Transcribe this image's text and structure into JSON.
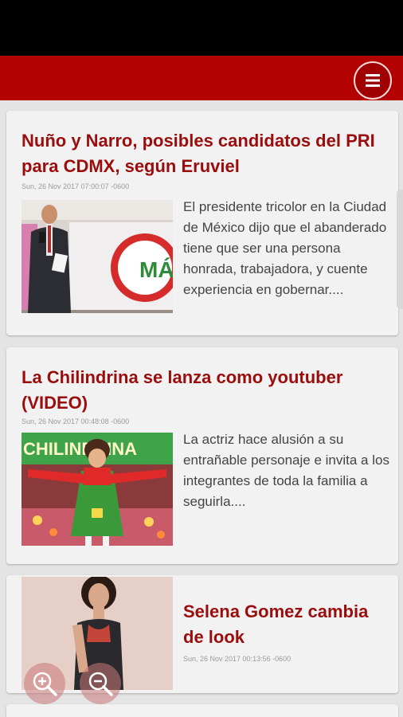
{
  "articles": [
    {
      "title": "Nuño y Narro, posibles candidatos del PRI para CDMX, según Eruviel",
      "date": "Sun, 26 Nov 2017 07:00:07 -0600",
      "excerpt": "El presidente tricolor en la Ciudad de México dijo que el abanderado tiene que ser una persona honrada, trabajadora, y cuente experiencia en gobernar....",
      "image_text": "MÁ"
    },
    {
      "title": "La Chilindrina se lanza como youtuber (VIDEO)",
      "date": "Sun, 26 Nov 2017 00:48:08 -0600",
      "excerpt": "La actriz hace alusión a su entrañable personaje e invita a los integrantes de toda la familia a seguirla....",
      "image_text": "CHILINDRINA"
    },
    {
      "title": "Selena Gomez cambia de look",
      "date": "Sun, 26 Nov 2017 00:13:56 -0600"
    }
  ],
  "colors": {
    "accent": "#b30000",
    "title": "#9b0d0d"
  },
  "icons": {
    "menu": "hamburger-icon",
    "zoom_in": "zoom-in-icon",
    "zoom_out": "zoom-out-icon"
  }
}
